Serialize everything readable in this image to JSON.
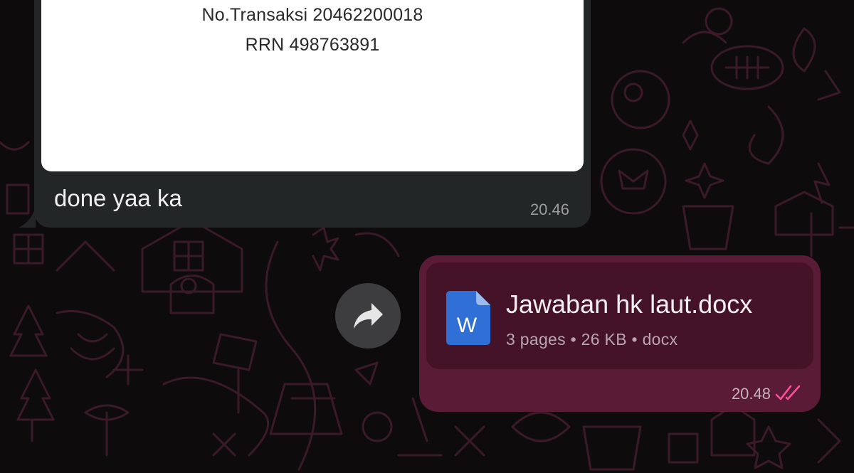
{
  "incoming": {
    "receipt": {
      "transaction_line": "No.Transaksi 20462200018",
      "rrn_line": "RRN 498763891"
    },
    "text": "done yaa ka",
    "time": "20.46"
  },
  "outgoing": {
    "document": {
      "file_name": "Jawaban hk laut.docx",
      "meta": "3 pages • 26 KB • docx",
      "icon": "word-document-icon",
      "icon_letter": "W"
    },
    "time": "20.48",
    "status_icon": "double-check-read-icon"
  },
  "actions": {
    "forward_icon": "forward-arrow-icon"
  },
  "colors": {
    "background": "#0e0b0d",
    "incoming_bubble": "#232626",
    "outgoing_bubble": "#5a1b36",
    "document_card": "#451328",
    "read_ticks": "#ff4f9a",
    "word_blue": "#2f6fd6"
  }
}
